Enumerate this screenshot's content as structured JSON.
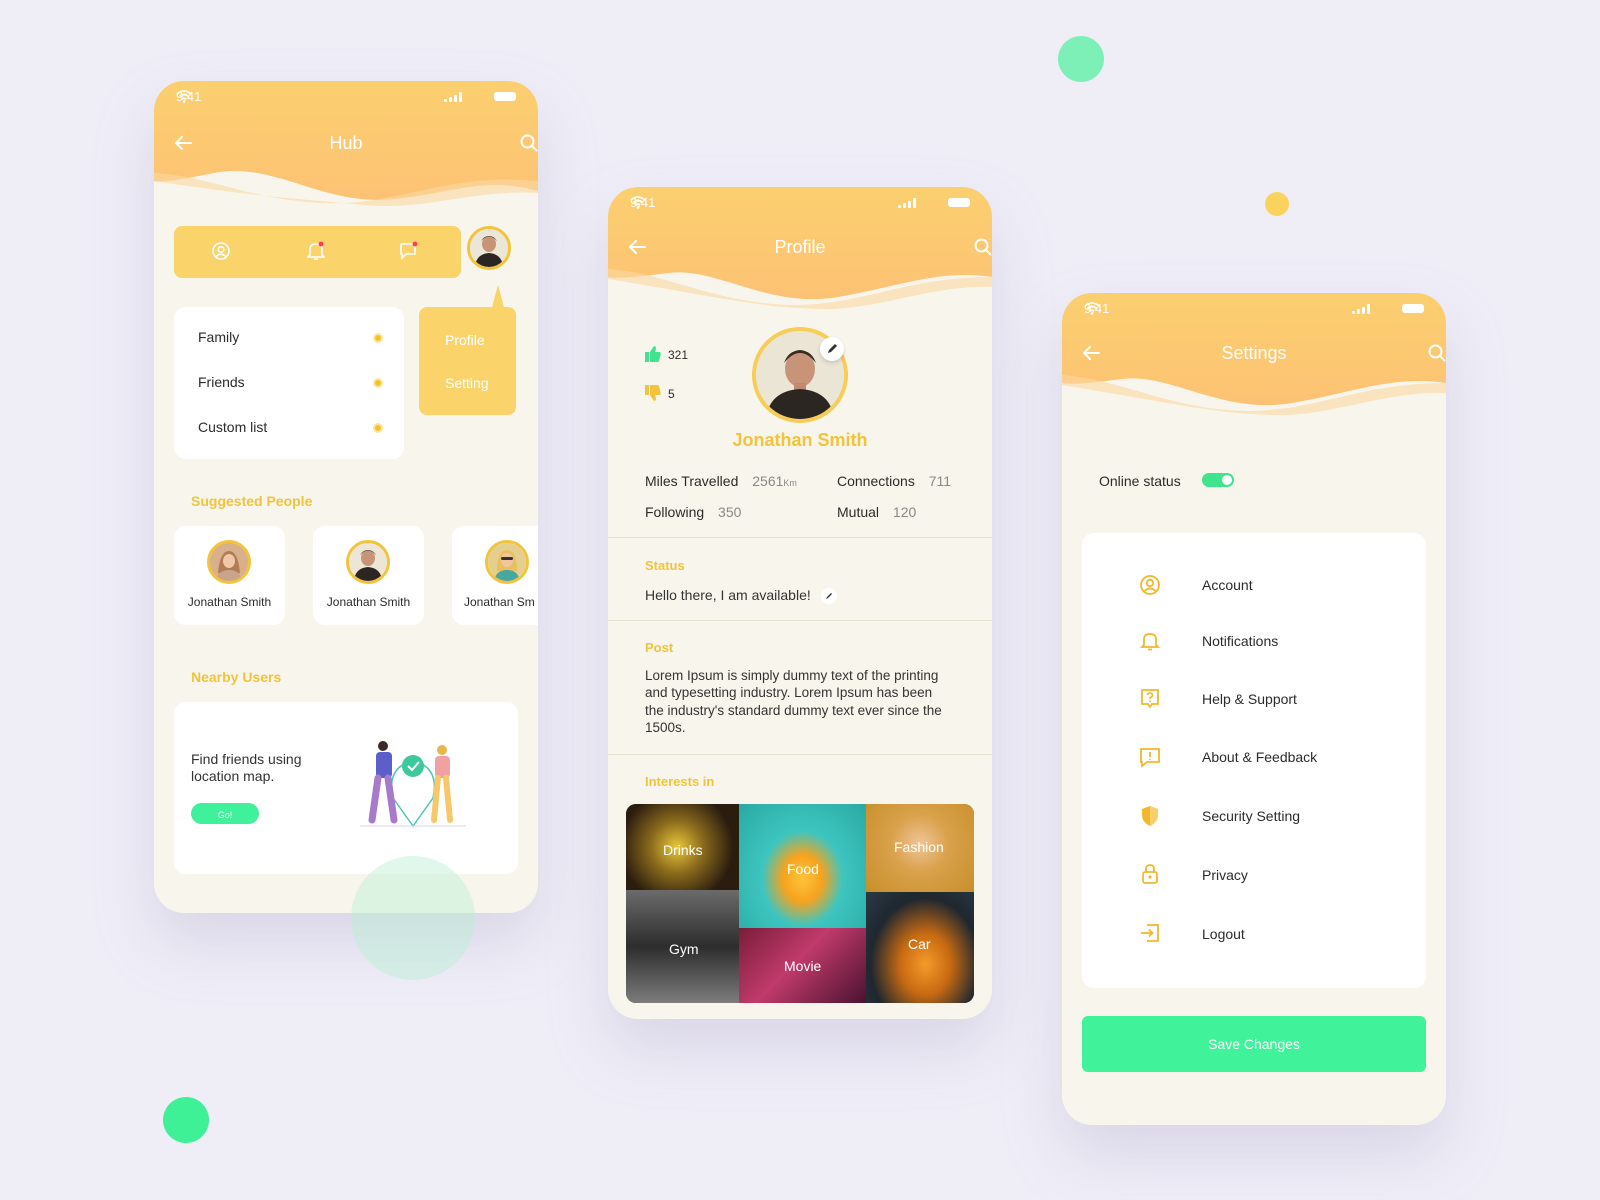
{
  "colors": {
    "yellow": "#fbd06e",
    "accent": "#f2c33b",
    "green": "#3ff19a",
    "bg": "#efeef7",
    "card": "#f8f6ec"
  },
  "status_time": "9:41",
  "hub": {
    "title": "Hub",
    "lists": [
      {
        "label": "Family",
        "icon": "dot-icon"
      },
      {
        "label": "Friends",
        "icon": "dot-icon"
      },
      {
        "label": "Custom list",
        "icon": "dot-icon"
      }
    ],
    "popup": [
      "Profile",
      "Setting"
    ],
    "suggested_title": "Suggested People",
    "suggested": [
      {
        "name": "Jonathan Smith"
      },
      {
        "name": "Jonathan Smith"
      },
      {
        "name": "Jonathan Sm"
      }
    ],
    "nearby_title": "Nearby Users",
    "nearby_text": "Find friends using location map.",
    "go_label": "Go!"
  },
  "profile": {
    "title": "Profile",
    "likes": "321",
    "dislikes": "5",
    "name": "Jonathan Smith",
    "stats": [
      {
        "label": "Miles Travelled",
        "value": "2561",
        "unit": "Km"
      },
      {
        "label": "Connections",
        "value": "711"
      },
      {
        "label": "Following",
        "value": "350"
      },
      {
        "label": "Mutual",
        "value": "120"
      }
    ],
    "status_title": "Status",
    "status_text": "Hello there, I am available!",
    "post_title": "Post",
    "post_text": "Lorem Ipsum is simply dummy text of the printing and typesetting industry. Lorem Ipsum has been the industry's standard dummy text ever since the 1500s.",
    "interests_title": "Interests in",
    "interests": [
      "Drinks",
      "Food",
      "Fashion",
      "Gym",
      "Movie",
      "Car"
    ]
  },
  "settings": {
    "title": "Settings",
    "online_label": "Online status",
    "online_on": true,
    "items": [
      {
        "label": "Account",
        "icon": "user-circle-icon"
      },
      {
        "label": "Notifications",
        "icon": "bell-icon"
      },
      {
        "label": "Help & Support",
        "icon": "help-icon"
      },
      {
        "label": "About & Feedback",
        "icon": "feedback-icon"
      },
      {
        "label": "Security Setting",
        "icon": "shield-icon"
      },
      {
        "label": "Privacy",
        "icon": "lock-icon"
      },
      {
        "label": "Logout",
        "icon": "logout-icon"
      }
    ],
    "save_label": "Save Changes"
  }
}
